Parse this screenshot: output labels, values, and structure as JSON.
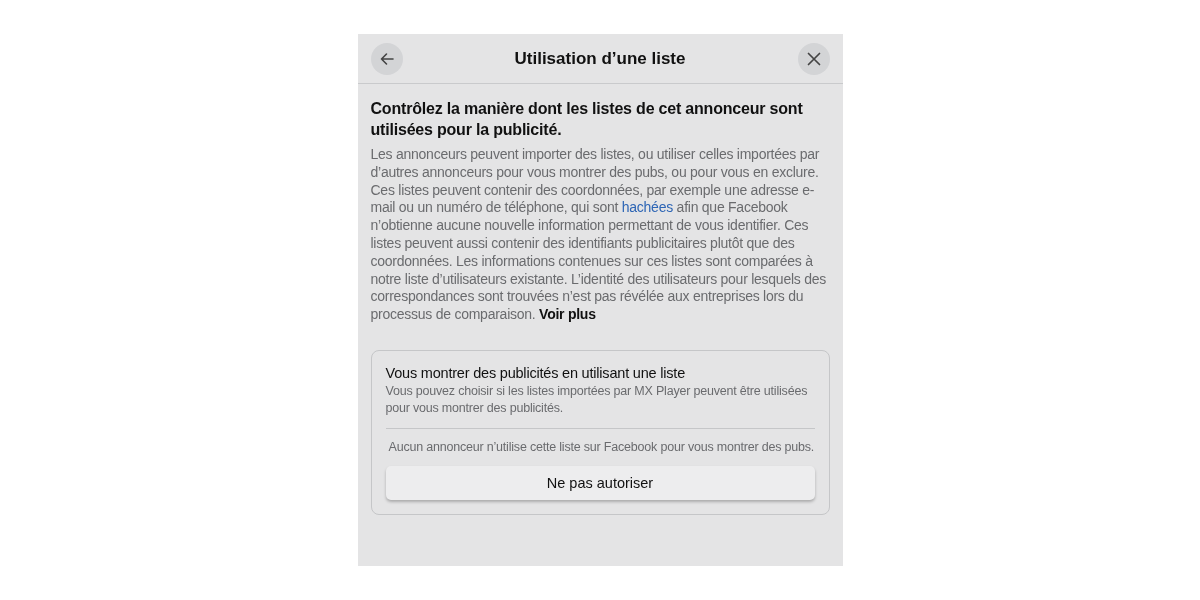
{
  "dialog": {
    "title": "Utilisation d’une liste",
    "heading": "Contrôlez la manière dont les listes de cet annonceur sont utilisées pour la publicité.",
    "body": {
      "before": "Les annonceurs peuvent importer des listes, ou utiliser celles importées par d’autres annonceurs pour vous montrer des pubs, ou pour vous en exclure. Ces listes peuvent contenir des coordonnées, par exemple une adresse e-mail ou un numéro de téléphone, qui sont",
      "link": "hachées",
      "after": "afin que Facebook n’obtienne aucune nouvelle information permettant de vous identifier. Ces listes peuvent aussi contenir des identifiants publicitaires plutôt que des coordonnées. Les informations contenues sur ces listes sont comparées à notre liste d’utilisateurs existante. L’identité des utilisateurs pour lesquels des correspondances sont trouvées n’est pas révélée aux entreprises lors du processus de comparaison.",
      "more": "Voir plus"
    },
    "card": {
      "title": "Vous montrer des publicités en utilisant une liste",
      "description": "Vous pouvez choisir si les listes importées par MX Player peuvent être utilisées pour vous montrer des publicités.",
      "status": "Aucun annonceur n’utilise cette liste sur Facebook pour vous montrer des pubs.",
      "button": "Ne pas autoriser"
    }
  }
}
